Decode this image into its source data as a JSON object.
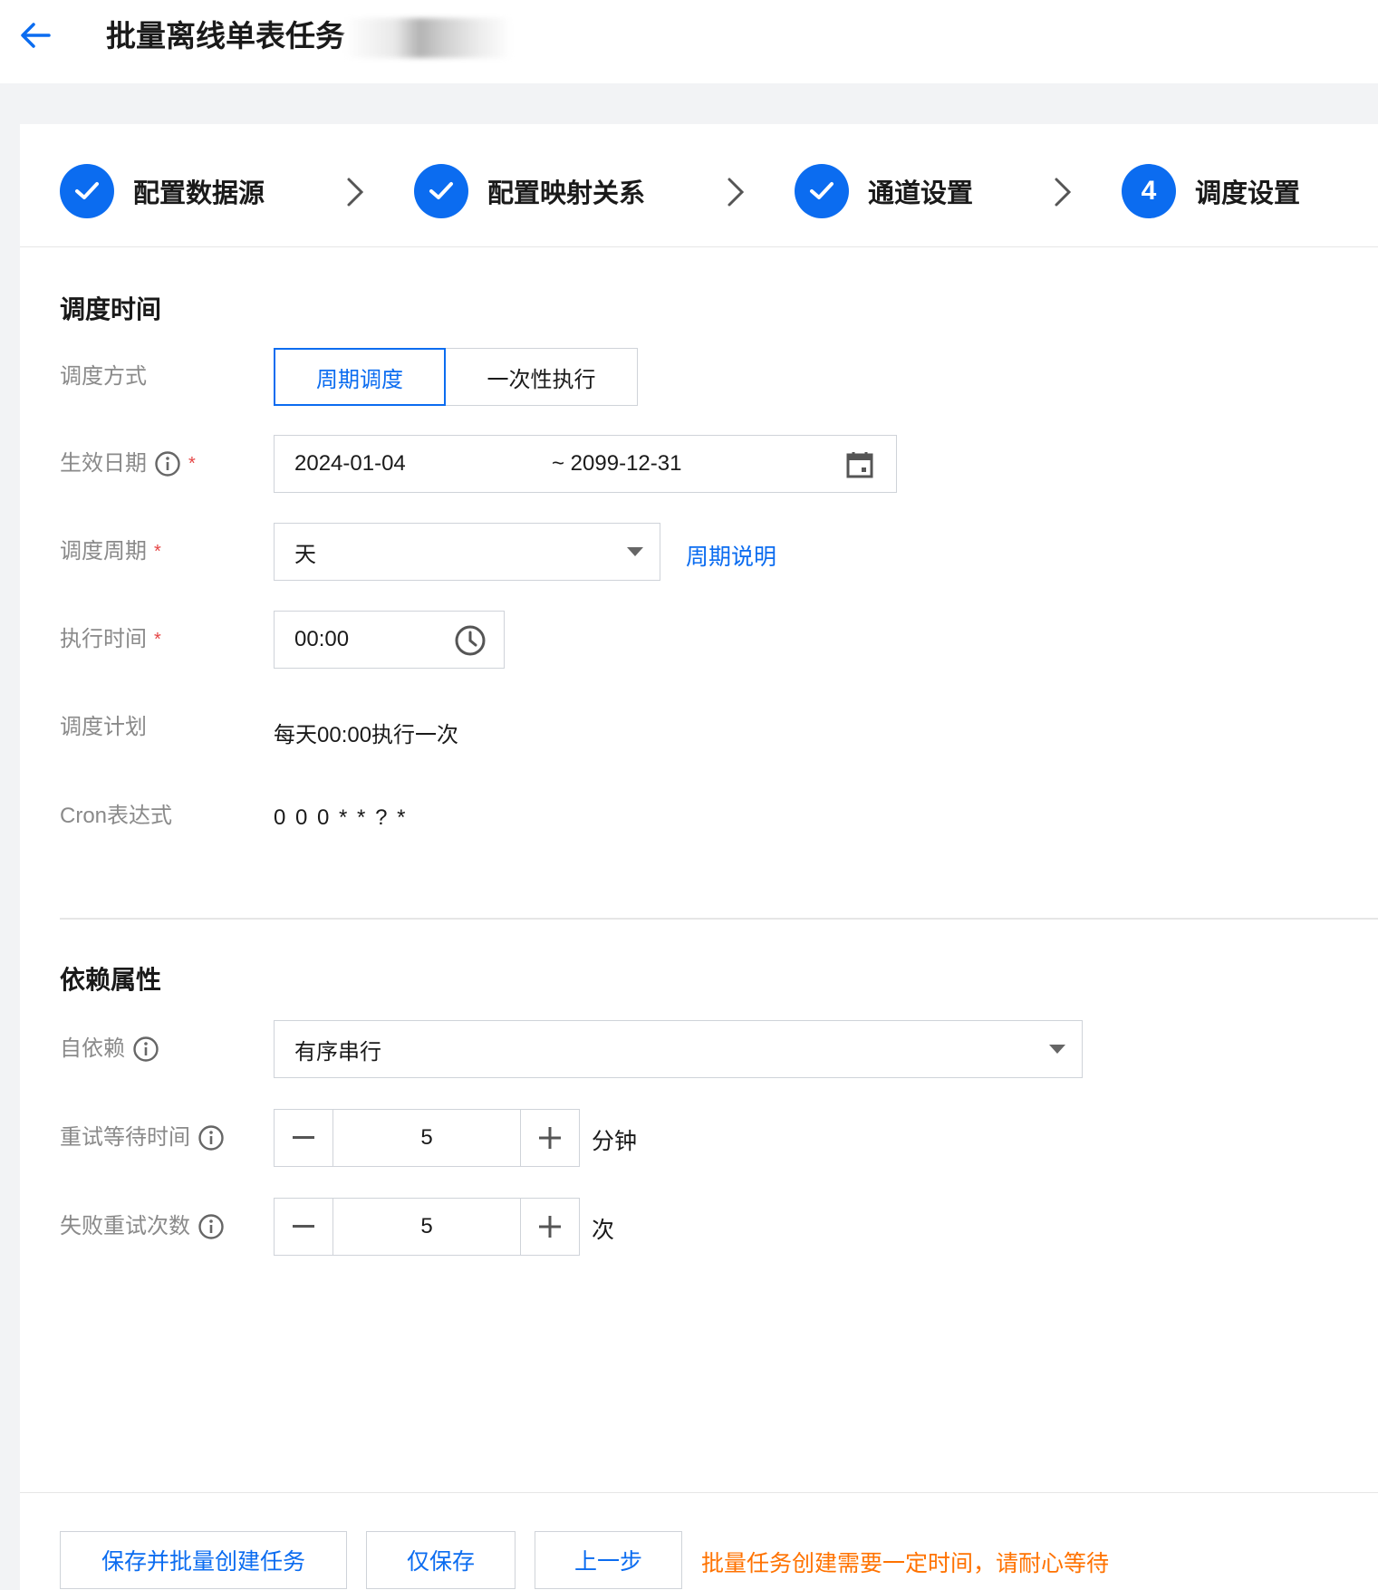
{
  "header": {
    "title": "批量离线单表任务"
  },
  "steps": [
    {
      "label": "配置数据源",
      "status": "done"
    },
    {
      "label": "配置映射关系",
      "status": "done"
    },
    {
      "label": "通道设置",
      "status": "done"
    },
    {
      "label": "调度设置",
      "status": "current",
      "number": "4"
    }
  ],
  "schedule": {
    "section_title": "调度时间",
    "mode_label": "调度方式",
    "mode_options": [
      "周期调度",
      "一次性执行"
    ],
    "mode_selected": "周期调度",
    "effective_label": "生效日期",
    "effective_start": "2024-01-04",
    "effective_end": "~ 2099-12-31",
    "cycle_label": "调度周期",
    "cycle_value": "天",
    "cycle_help_link": "周期说明",
    "exec_time_label": "执行时间",
    "exec_time_value": "00:00",
    "plan_label": "调度计划",
    "plan_value": "每天00:00执行一次",
    "cron_label": "Cron表达式",
    "cron_value": "0 0 0 * * ? *"
  },
  "dependency": {
    "section_title": "依赖属性",
    "self_dep_label": "自依赖",
    "self_dep_value": "有序串行",
    "retry_wait_label": "重试等待时间",
    "retry_wait_value": "5",
    "retry_wait_unit": "分钟",
    "retry_count_label": "失败重试次数",
    "retry_count_value": "5",
    "retry_count_unit": "次"
  },
  "footer": {
    "save_create_label": "保存并批量创建任务",
    "save_only_label": "仅保存",
    "prev_label": "上一步",
    "note": "批量任务创建需要一定时间，请耐心等待"
  },
  "colors": {
    "primary": "#0b6cf0",
    "required": "#e54545",
    "warning": "#ff7200",
    "label_gray": "#8a8a8a"
  }
}
